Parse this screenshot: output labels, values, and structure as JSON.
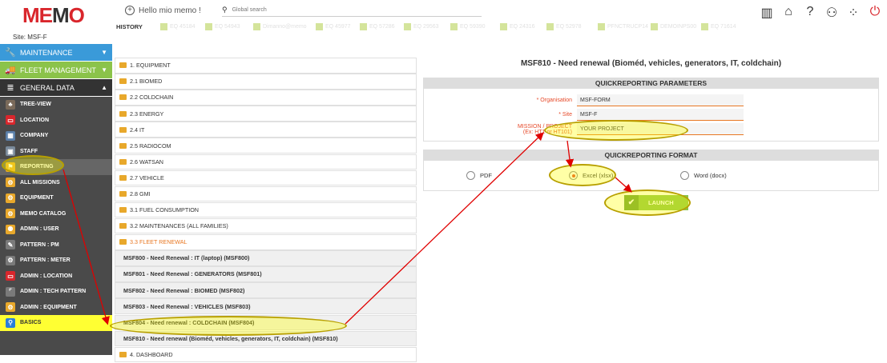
{
  "logo": {
    "part1": "ME",
    "part2": "M",
    "part3": "O"
  },
  "site": "Site: MSF-F",
  "modules": [
    {
      "label": "MAINTENANCE",
      "icon": "wrench-icon"
    },
    {
      "label": "FLEET MANAGEMENT",
      "icon": "truck-icon"
    },
    {
      "label": "GENERAL DATA",
      "icon": "database-icon"
    }
  ],
  "sidebar": {
    "items": [
      {
        "label": "TREE-VIEW"
      },
      {
        "label": "LOCATION"
      },
      {
        "label": "COMPANY"
      },
      {
        "label": "STAFF"
      },
      {
        "label": "REPORTING"
      },
      {
        "label": "ALL MISSIONS"
      },
      {
        "label": "EQUIPMENT"
      },
      {
        "label": "MEMO CATALOG"
      },
      {
        "label": "ADMIN : USER"
      },
      {
        "label": "PATTERN : PM"
      },
      {
        "label": "PATTERN : METER"
      },
      {
        "label": "ADMIN : LOCATION"
      },
      {
        "label": "ADMIN : TECH PATTERN"
      },
      {
        "label": "ADMIN : EQUIPMENT"
      },
      {
        "label": "BASICS"
      }
    ]
  },
  "topbar": {
    "hello": "Hello mio memo !",
    "search_placeholder": "Global search",
    "history_label": "HISTORY",
    "history_tabs": [
      "EQ 45184",
      "EQ 54943",
      "Dimanno@memo",
      "EQ 45977",
      "EQ 57286",
      "EQ 29563",
      "EQ 59390",
      "EQ 24316",
      "EQ 52978",
      "PFNCTRUCP14",
      "DEMOINPS00",
      "EQ 71614"
    ]
  },
  "tree": {
    "nodes": [
      {
        "label": "1. EQUIPMENT",
        "type": "folder"
      },
      {
        "label": "2.1 BIOMED",
        "type": "folder"
      },
      {
        "label": "2.2 COLDCHAIN",
        "type": "folder"
      },
      {
        "label": "2.3 ENERGY",
        "type": "folder"
      },
      {
        "label": "2.4 IT",
        "type": "folder"
      },
      {
        "label": "2.5 RADIOCOM",
        "type": "folder"
      },
      {
        "label": "2.6 WATSAN",
        "type": "folder"
      },
      {
        "label": "2.7 VEHICLE",
        "type": "folder"
      },
      {
        "label": "2.8 GMI",
        "type": "folder"
      },
      {
        "label": "3.1 FUEL CONSUMPTION",
        "type": "folder"
      },
      {
        "label": "3.2 MAINTENANCES (ALL FAMILIES)",
        "type": "folder"
      },
      {
        "label": "3.3 FLEET RENEWAL",
        "type": "open"
      },
      {
        "label": "MSF800 - Need Renewal : IT (laptop) (MSF800)",
        "type": "leaf"
      },
      {
        "label": "MSF801 - Need Renewal : GENERATORS (MSF801)",
        "type": "leaf"
      },
      {
        "label": "MSF802 - Need Renewal : BIOMED (MSF802)",
        "type": "leaf"
      },
      {
        "label": "MSF803 - Need Renewal : VEHICLES (MSF803)",
        "type": "leaf"
      },
      {
        "label": "MSF804 - Need renewal : COLDCHAIN (MSF804)",
        "type": "leaf"
      },
      {
        "label": "MSF810 - Need renewal (Bioméd, vehicles, generators, IT, coldchain) (MSF810)",
        "type": "leaf"
      },
      {
        "label": "4. DASHBOARD",
        "type": "folder"
      }
    ]
  },
  "report": {
    "title": "MSF810 - Need renewal (Bioméd, vehicles, generators, IT, coldchain)",
    "params_header": "QUICKREPORTING PARAMETERS",
    "fields": [
      {
        "label": "* Organisation",
        "value": "MSF-FORM"
      },
      {
        "label": "* Site",
        "value": "MSF-F"
      },
      {
        "label": "MISSION / PROJECT (Ex: HT1 or HT101)",
        "value": "YOUR PROJECT"
      }
    ],
    "format_header": "QUICKREPORTING FORMAT",
    "formats": [
      {
        "label": "PDF",
        "selected": false
      },
      {
        "label": "Excel (xlsx)",
        "selected": true
      },
      {
        "label": "Word (docx)",
        "selected": false
      }
    ],
    "launch_label": "LAUNCH"
  },
  "colors": {
    "accent": "#e87722",
    "maintenance": "#3a9ad9",
    "fleet": "#8bc34a",
    "highlight": "#ffff33",
    "arrow": "#e00000"
  }
}
